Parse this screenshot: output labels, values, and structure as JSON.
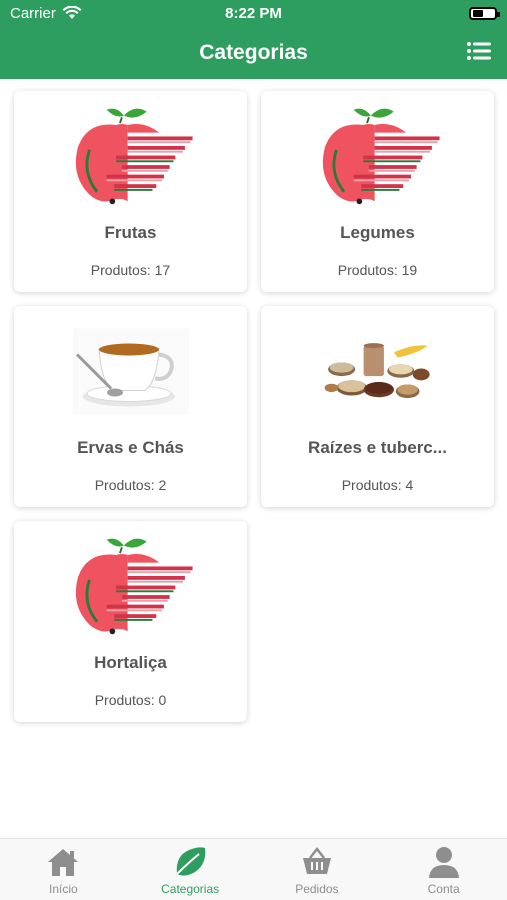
{
  "status_bar": {
    "carrier": "Carrier",
    "time": "8:22 PM"
  },
  "header": {
    "title": "Categorias",
    "menu_icon": "list-icon"
  },
  "colors": {
    "primary": "#2e9e60",
    "card_text": "#555555",
    "tab_inactive": "#8e8e8e"
  },
  "categories": [
    {
      "name": "Frutas",
      "count_label": "Produtos:",
      "count": "17",
      "image": "apple-logo"
    },
    {
      "name": "Legumes",
      "count_label": "Produtos:",
      "count": "19",
      "image": "apple-logo"
    },
    {
      "name": "Ervas e Chás",
      "count_label": "Produtos:",
      "count": "2",
      "image": "tea-cup"
    },
    {
      "name": "Raízes e tuberc...",
      "count_label": "Produtos:",
      "count": "4",
      "image": "grains-bowls"
    },
    {
      "name": "Hortaliça",
      "count_label": "Produtos:",
      "count": "0",
      "image": "apple-logo"
    }
  ],
  "tabs": [
    {
      "label": "Início",
      "icon": "home-icon",
      "active": false
    },
    {
      "label": "Categorias",
      "icon": "leaf-icon",
      "active": true
    },
    {
      "label": "Pedidos",
      "icon": "basket-icon",
      "active": false
    },
    {
      "label": "Conta",
      "icon": "user-icon",
      "active": false
    }
  ]
}
